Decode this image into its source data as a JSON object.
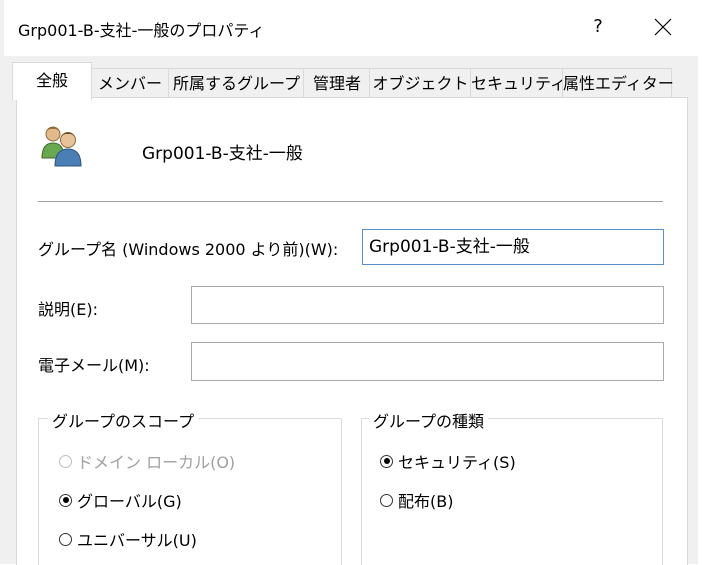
{
  "window": {
    "title": "Grp001-B-支社-一般のプロパティ",
    "help_label": "?",
    "close_icon": "close-icon"
  },
  "tabs": [
    {
      "label": "全般",
      "active": true
    },
    {
      "label": "メンバー"
    },
    {
      "label": "所属するグループ"
    },
    {
      "label": "管理者"
    },
    {
      "label": "オブジェクト"
    },
    {
      "label": "セキュリティ"
    },
    {
      "label": "属性エディター"
    }
  ],
  "general": {
    "group_icon": "users-group-icon",
    "group_name": "Grp001-B-支社-一般",
    "pre2000_label": "グループ名 (Windows 2000 より前)(W):",
    "pre2000_value": "Grp001-B-支社-一般",
    "description_label": "説明(E):",
    "description_value": "",
    "email_label": "電子メール(M):",
    "email_value": ""
  },
  "scope": {
    "title": "グループのスコープ",
    "options": [
      {
        "label": "ドメイン ローカル(O)",
        "checked": false,
        "disabled": true
      },
      {
        "label": "グローバル(G)",
        "checked": true,
        "disabled": false
      },
      {
        "label": "ユニバーサル(U)",
        "checked": false,
        "disabled": false
      }
    ]
  },
  "type": {
    "title": "グループの種類",
    "options": [
      {
        "label": "セキュリティ(S)",
        "checked": true
      },
      {
        "label": "配布(B)",
        "checked": false
      }
    ]
  }
}
